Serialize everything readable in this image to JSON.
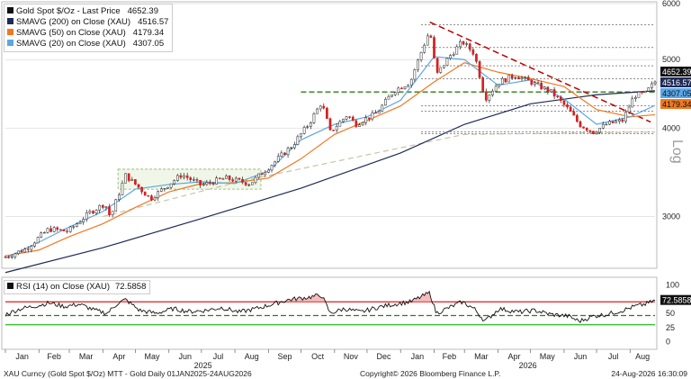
{
  "colors": {
    "price": "#111111",
    "sma200": "#1f2a55",
    "sma50": "#f07820",
    "sma20": "#5aa7e6",
    "rsi_line": "#111111",
    "rsi_upper": "#e03030",
    "rsi_lower": "#37c337",
    "resistance": "#c00000",
    "support": "#2e7d1a",
    "sma200_projection": "#c9c2a8"
  },
  "chart_data": [
    {
      "type": "candlestick",
      "title": "",
      "scale": "log",
      "ylim": [
        2550,
        6000
      ],
      "grid": true,
      "legend_position": "top-left",
      "yticks": [
        3000,
        4000,
        5000,
        6000
      ],
      "yaxis_annotation": "Log",
      "x_start": "2025-01-01",
      "x_end": "2026-08-24",
      "series": [
        {
          "name": "Gold Spot $/Oz - Last Price",
          "last": "4652.39",
          "kind": "price",
          "points": [
            [
              "2025-01-01",
              2630
            ],
            [
              "2025-01-20",
              2700
            ],
            [
              "2025-02-10",
              2880
            ],
            [
              "2025-02-28",
              2860
            ],
            [
              "2025-03-20",
              3040
            ],
            [
              "2025-04-03",
              3130
            ],
            [
              "2025-04-08",
              2990
            ],
            [
              "2025-04-22",
              3430
            ],
            [
              "2025-05-15",
              3180
            ],
            [
              "2025-06-13",
              3440
            ],
            [
              "2025-07-01",
              3320
            ],
            [
              "2025-07-23",
              3400
            ],
            [
              "2025-08-15",
              3340
            ],
            [
              "2025-09-02",
              3530
            ],
            [
              "2025-09-23",
              3780
            ],
            [
              "2025-10-08",
              4050
            ],
            [
              "2025-10-20",
              4350
            ],
            [
              "2025-10-28",
              3950
            ],
            [
              "2025-11-13",
              4180
            ],
            [
              "2025-11-20",
              4050
            ],
            [
              "2025-12-10",
              4200
            ],
            [
              "2025-12-26",
              4520
            ],
            [
              "2026-01-10",
              4650
            ],
            [
              "2026-01-28",
              5500
            ],
            [
              "2026-02-03",
              4750
            ],
            [
              "2026-02-15",
              5050
            ],
            [
              "2026-02-27",
              5300
            ],
            [
              "2026-03-10",
              5100
            ],
            [
              "2026-03-20",
              4400
            ],
            [
              "2026-04-02",
              4650
            ],
            [
              "2026-04-17",
              4750
            ],
            [
              "2026-05-01",
              4650
            ],
            [
              "2026-05-20",
              4500
            ],
            [
              "2026-06-05",
              4250
            ],
            [
              "2026-06-15",
              4050
            ],
            [
              "2026-06-28",
              3950
            ],
            [
              "2026-07-10",
              4050
            ],
            [
              "2026-07-25",
              4100
            ],
            [
              "2026-08-05",
              4450
            ],
            [
              "2026-08-15",
              4480
            ],
            [
              "2026-08-24",
              4652
            ]
          ]
        },
        {
          "name": "SMAVG (200) on Close (XAU)",
          "last": "4516.57",
          "kind": "sma200",
          "points": [
            [
              "2025-01-01",
              2500
            ],
            [
              "2025-04-01",
              2710
            ],
            [
              "2025-07-01",
              2980
            ],
            [
              "2025-10-01",
              3290
            ],
            [
              "2026-01-01",
              3690
            ],
            [
              "2026-03-01",
              4050
            ],
            [
              "2026-05-01",
              4330
            ],
            [
              "2026-07-01",
              4460
            ],
            [
              "2026-08-24",
              4517
            ]
          ]
        },
        {
          "name": "SMAVG (50) on Close (XAU)",
          "last": "4179.34",
          "kind": "sma50",
          "points": [
            [
              "2025-01-01",
              2640
            ],
            [
              "2025-02-01",
              2690
            ],
            [
              "2025-03-01",
              2810
            ],
            [
              "2025-04-01",
              2930
            ],
            [
              "2025-05-01",
              3090
            ],
            [
              "2025-06-01",
              3250
            ],
            [
              "2025-07-01",
              3340
            ],
            [
              "2025-08-01",
              3350
            ],
            [
              "2025-09-01",
              3400
            ],
            [
              "2025-10-01",
              3620
            ],
            [
              "2025-11-01",
              3920
            ],
            [
              "2025-12-01",
              4100
            ],
            [
              "2026-01-01",
              4300
            ],
            [
              "2026-02-01",
              4650
            ],
            [
              "2026-03-01",
              4950
            ],
            [
              "2026-04-01",
              4800
            ],
            [
              "2026-05-01",
              4700
            ],
            [
              "2026-06-01",
              4580
            ],
            [
              "2026-07-01",
              4250
            ],
            [
              "2026-08-01",
              4150
            ],
            [
              "2026-08-24",
              4179
            ]
          ]
        },
        {
          "name": "SMAVG (20) on Close (XAU)",
          "last": "4307.05",
          "kind": "sma20",
          "points": [
            [
              "2025-01-01",
              2620
            ],
            [
              "2025-02-01",
              2760
            ],
            [
              "2025-03-01",
              2900
            ],
            [
              "2025-04-01",
              3050
            ],
            [
              "2025-05-01",
              3280
            ],
            [
              "2025-06-01",
              3330
            ],
            [
              "2025-07-01",
              3360
            ],
            [
              "2025-08-01",
              3340
            ],
            [
              "2025-09-01",
              3480
            ],
            [
              "2025-10-01",
              3850
            ],
            [
              "2025-11-01",
              4050
            ],
            [
              "2025-12-01",
              4150
            ],
            [
              "2026-01-01",
              4380
            ],
            [
              "2026-02-01",
              5050
            ],
            [
              "2026-03-01",
              5000
            ],
            [
              "2026-04-01",
              4600
            ],
            [
              "2026-05-01",
              4680
            ],
            [
              "2026-06-01",
              4400
            ],
            [
              "2026-07-01",
              4050
            ],
            [
              "2026-08-01",
              4150
            ],
            [
              "2026-08-24",
              4307
            ]
          ]
        }
      ],
      "overlays": {
        "resistance_trendline": [
          [
            "2026-01-28",
            5650
          ],
          [
            "2026-08-20",
            4080
          ]
        ],
        "support_dashed": [
          {
            "x0": "2025-10-01",
            "x1": "2026-08-24",
            "y": 4500
          }
        ],
        "consolidation_box": {
          "x0": "2025-04-15",
          "x1": "2025-08-25",
          "y0": 3280,
          "y1": 3500
        },
        "sma200_projection": [
          [
            "2025-04-01",
            3000
          ],
          [
            "2025-08-01",
            3350
          ],
          [
            "2026-03-01",
            3920
          ],
          [
            "2026-08-24",
            3950
          ]
        ],
        "horizontal_levels": [
          5600,
          5200,
          4900,
          4700,
          4300,
          4230,
          3950,
          3930
        ]
      }
    },
    {
      "type": "line",
      "title": "RSI (14) on Close (XAU) 72.5858",
      "ylim": [
        -10,
        110
      ],
      "yticks": [
        0,
        25,
        50,
        75,
        100
      ],
      "upper_band": 70,
      "lower_band": 30,
      "support_dashed_level": 46,
      "last": "72.5858",
      "grid": true,
      "points": [
        [
          "2025-01-01",
          48
        ],
        [
          "2025-01-15",
          58
        ],
        [
          "2025-02-01",
          64
        ],
        [
          "2025-02-10",
          68
        ],
        [
          "2025-02-25",
          62
        ],
        [
          "2025-03-10",
          66
        ],
        [
          "2025-03-25",
          55
        ],
        [
          "2025-04-05",
          50
        ],
        [
          "2025-04-15",
          68
        ],
        [
          "2025-04-22",
          74
        ],
        [
          "2025-05-05",
          55
        ],
        [
          "2025-05-20",
          50
        ],
        [
          "2025-06-05",
          58
        ],
        [
          "2025-06-20",
          53
        ],
        [
          "2025-07-05",
          55
        ],
        [
          "2025-07-20",
          60
        ],
        [
          "2025-08-05",
          52
        ],
        [
          "2025-08-20",
          58
        ],
        [
          "2025-09-05",
          66
        ],
        [
          "2025-09-20",
          74
        ],
        [
          "2025-10-08",
          78
        ],
        [
          "2025-10-20",
          82
        ],
        [
          "2025-10-28",
          50
        ],
        [
          "2025-11-10",
          58
        ],
        [
          "2025-11-25",
          52
        ],
        [
          "2025-12-10",
          60
        ],
        [
          "2025-12-26",
          66
        ],
        [
          "2026-01-10",
          70
        ],
        [
          "2026-01-28",
          86
        ],
        [
          "2026-02-03",
          50
        ],
        [
          "2026-02-15",
          60
        ],
        [
          "2026-02-27",
          70
        ],
        [
          "2026-03-10",
          58
        ],
        [
          "2026-03-20",
          36
        ],
        [
          "2026-04-02",
          58
        ],
        [
          "2026-04-20",
          52
        ],
        [
          "2026-05-05",
          55
        ],
        [
          "2026-05-20",
          48
        ],
        [
          "2026-06-05",
          45
        ],
        [
          "2026-06-15",
          36
        ],
        [
          "2026-06-28",
          45
        ],
        [
          "2026-07-10",
          48
        ],
        [
          "2026-07-25",
          55
        ],
        [
          "2026-08-05",
          62
        ],
        [
          "2026-08-15",
          66
        ],
        [
          "2026-08-24",
          72.59
        ]
      ]
    }
  ],
  "legend": [
    {
      "label": "Gold Spot $/Oz - Last Price",
      "value": "4652.39",
      "color": "#111111"
    },
    {
      "label": "SMAVG (200) on Close (XAU)",
      "value": "4516.57",
      "color": "#1f2a55"
    },
    {
      "label": "SMAVG (50) on Close (XAU)",
      "value": "4179.34",
      "color": "#f07820"
    },
    {
      "label": "SMAVG (20) on Close (XAU)",
      "value": "4307.05",
      "color": "#5aa7e6"
    }
  ],
  "rsi_legend": {
    "label": "RSI (14) on Close (XAU)",
    "value": "72.5858"
  },
  "price_labels": [
    {
      "text": "4652.39",
      "bg": "#111111",
      "fg": "#ffffff"
    },
    {
      "text": "4516.57",
      "bg": "#1f2a55",
      "fg": "#ffffff"
    },
    {
      "text": "4307.05",
      "bg": "#5aa7e6",
      "fg": "#111111"
    },
    {
      "text": "4179.34",
      "bg": "#f07820",
      "fg": "#111111"
    }
  ],
  "rsi_label": {
    "text": "72.5858",
    "bg": "#111111",
    "fg": "#ffffff"
  },
  "x_axis": {
    "months": [
      "Jan",
      "Feb",
      "Mar",
      "Apr",
      "May",
      "Jun",
      "Jul",
      "Aug",
      "Sep",
      "Oct",
      "Nov",
      "Dec",
      "Jan",
      "Feb",
      "Mar",
      "Apr",
      "May",
      "Jun",
      "Jul",
      "Aug"
    ],
    "years": [
      "2025",
      "2026"
    ]
  },
  "footer": {
    "left": "XAU Curncy (Gold Spot  $/Oz) MTT - Gold Daily 01JAN2025-24AUG2026",
    "center": "Copyright© 2026 Bloomberg Finance L.P.",
    "right": "24-Aug-2026 16:30:09"
  }
}
